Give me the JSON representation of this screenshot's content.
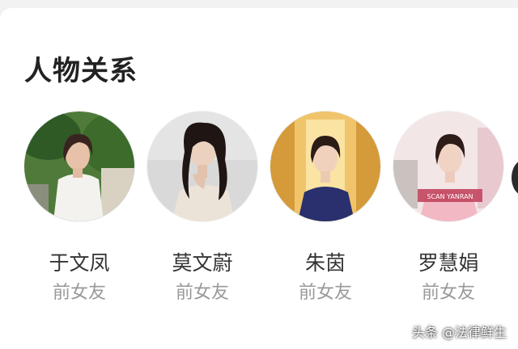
{
  "section": {
    "title": "人物关系"
  },
  "people": [
    {
      "name": "于文凤",
      "relation": "前女友",
      "photo_icon": "portrait-photo"
    },
    {
      "name": "莫文蔚",
      "relation": "前女友",
      "photo_icon": "portrait-photo"
    },
    {
      "name": "朱茵",
      "relation": "前女友",
      "photo_icon": "portrait-photo"
    },
    {
      "name": "罗慧娟",
      "relation": "前女友",
      "photo_icon": "portrait-photo"
    }
  ],
  "photo_text": {
    "scan_yanran": "SCAN YANRAN"
  },
  "watermark": "头条 @法律鲜生",
  "colors": {
    "title": "#222222",
    "name": "#333333",
    "relation": "#999999",
    "background": "#ffffff"
  }
}
